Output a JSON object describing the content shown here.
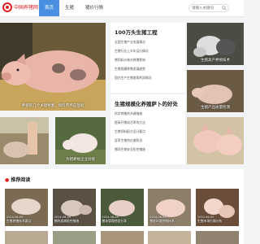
{
  "header": {
    "logo_text": "中国养猪网",
    "nav": [
      "首页",
      "生猪",
      "猪价行情"
    ],
    "search_placeholder": "请输入关键词"
  },
  "hero": {
    "caption": "养猪的几个关键要素，饲料营养是基础"
  },
  "left_small": [
    {
      "caption": ""
    },
    {
      "caption": "为猪养殖企业对接"
    }
  ],
  "panel1": {
    "title": "100万头生猪工程",
    "items": [
      "全国生猪产业发展情况",
      "生猪行业上半年运行情况",
      "猪饲料价格对养猪影响",
      "生猪规模养殖发展趋势",
      "国内生产生猪收购利润情况"
    ]
  },
  "panel2": {
    "title": "生猪规模化养殖萨卜的好处",
    "items": [
      "科学养猪的关键措施",
      "提高仔猪成活率的方法",
      "生猪饲料配方设计要点",
      "夏季生猪热应激防治",
      "猪场生物安全防控措施"
    ]
  },
  "right_photos": [
    {
      "caption": "生猪高产养殖技术"
    },
    {
      "caption": "生猪产品质量检测"
    },
    {
      "caption": ""
    }
  ],
  "recommend": {
    "title": "推荐阅读",
    "cards": [
      {
        "date": "2024-06-09",
        "caption": "生猪养殖技术要点"
      },
      {
        "date": "2024-06-09",
        "caption": "猪的疾病防控措施"
      },
      {
        "date": "2024-06-09",
        "caption": "猪场管理经验分享"
      },
      {
        "date": "2024-06-09",
        "caption": "猪舍环境控制技术"
      },
      {
        "date": "2024-06-09",
        "caption": "生猪市场行情分析"
      }
    ]
  },
  "colors": {
    "accent": "#4a90e2",
    "brand": "#e02020"
  }
}
